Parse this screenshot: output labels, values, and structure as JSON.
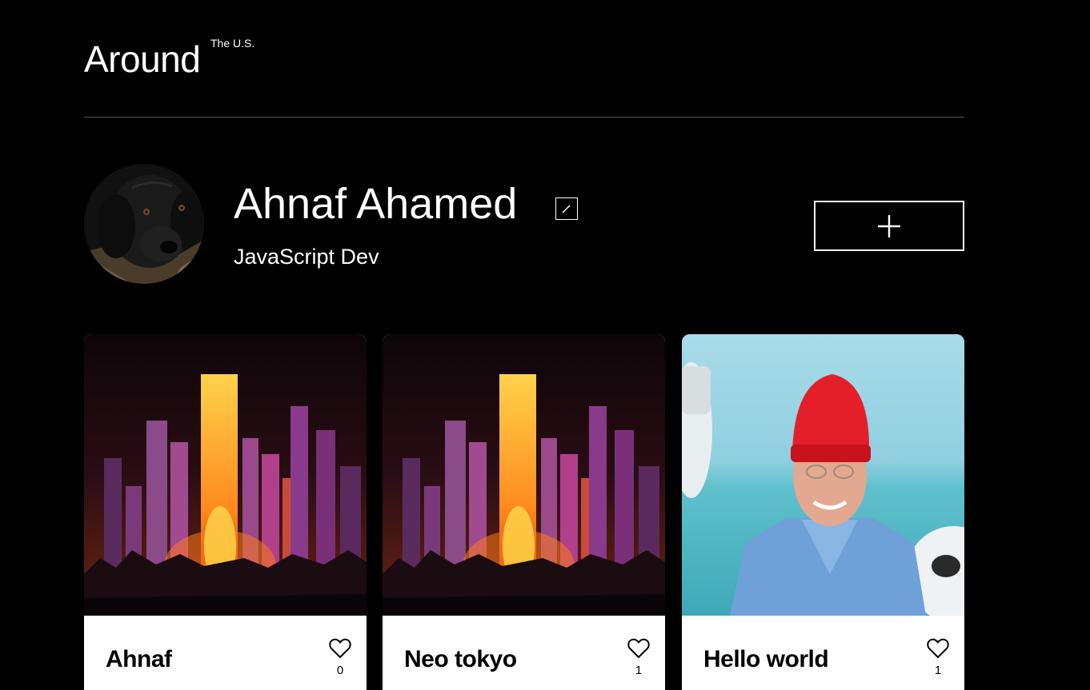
{
  "header": {
    "logo_main": "Around",
    "logo_sup": "The U.S."
  },
  "profile": {
    "name": "Ahnaf Ahamed",
    "job": "JavaScript Dev",
    "avatar_icon": "dog-photo",
    "edit_icon": "pencil-icon",
    "add_icon": "plus-icon"
  },
  "cards": [
    {
      "title": "Ahnaf",
      "likes": "0",
      "image": "neo-tokyo-city-image"
    },
    {
      "title": "Neo tokyo",
      "likes": "1",
      "image": "neo-tokyo-city-image"
    },
    {
      "title": "Hello world",
      "likes": "1",
      "image": "man-red-hat-image"
    }
  ],
  "colors": {
    "background": "#000000",
    "card": "#ffffff",
    "divider": "#545454"
  }
}
